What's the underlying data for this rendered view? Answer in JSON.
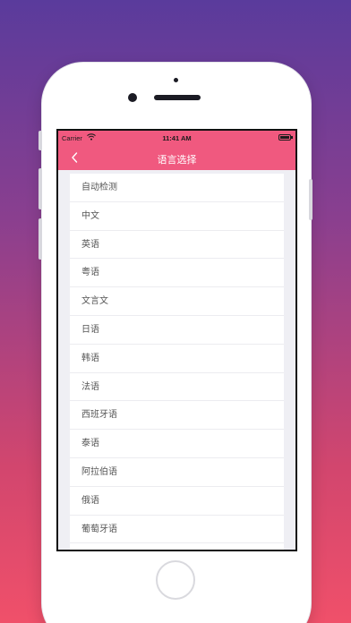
{
  "status_bar": {
    "carrier": "Carrier",
    "time": "11:41 AM"
  },
  "nav": {
    "title": "语言选择",
    "back_icon": "chevron-left-icon"
  },
  "languages": [
    {
      "label": "自动检测"
    },
    {
      "label": "中文"
    },
    {
      "label": "英语"
    },
    {
      "label": "粤语"
    },
    {
      "label": "文言文"
    },
    {
      "label": "日语"
    },
    {
      "label": "韩语"
    },
    {
      "label": "法语"
    },
    {
      "label": "西班牙语"
    },
    {
      "label": "泰语"
    },
    {
      "label": "阿拉伯语"
    },
    {
      "label": "俄语"
    },
    {
      "label": "葡萄牙语"
    }
  ],
  "colors": {
    "accent": "#f0597f",
    "background_top": "#5a3b9c",
    "background_bottom": "#f0506a"
  }
}
